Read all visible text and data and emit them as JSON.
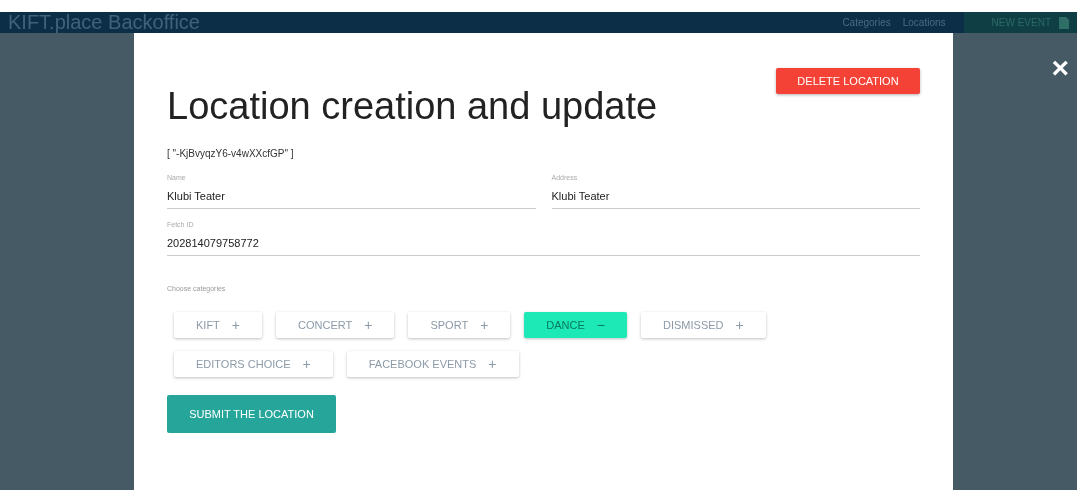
{
  "app_bar": {
    "title": "KIFT.place Backoffice",
    "nav": [
      "Categories",
      "Locations"
    ],
    "new_event_button": "NEW EVENT"
  },
  "modal": {
    "close_label": "×",
    "delete_button": "DELETE LOCATION",
    "title": "Location creation and update",
    "id_text": "[ \"-KjBvyqzY6-v4wXXcfGP\" ]",
    "field_rows": [
      [
        {
          "label": "Name",
          "value": "Klubi Teater"
        },
        {
          "label": "Address",
          "value": "Klubi Teater"
        }
      ],
      [
        {
          "label": "Fetch ID",
          "value": "202814079758772"
        }
      ]
    ],
    "categories_label": "Choose categories",
    "categories": [
      {
        "label": "KIFT",
        "sign": "+",
        "selected": false
      },
      {
        "label": "CONCERT",
        "sign": "+",
        "selected": false
      },
      {
        "label": "SPORT",
        "sign": "+",
        "selected": false
      },
      {
        "label": "DANCE",
        "sign": "−",
        "selected": true
      },
      {
        "label": "DISMISSED",
        "sign": "+",
        "selected": false
      },
      {
        "label": "EDITORS CHOICE",
        "sign": "+",
        "selected": false
      },
      {
        "label": "FACEBOOK EVENTS",
        "sign": "+",
        "selected": false
      }
    ],
    "submit_button": "SUBMIT THE LOCATION"
  }
}
